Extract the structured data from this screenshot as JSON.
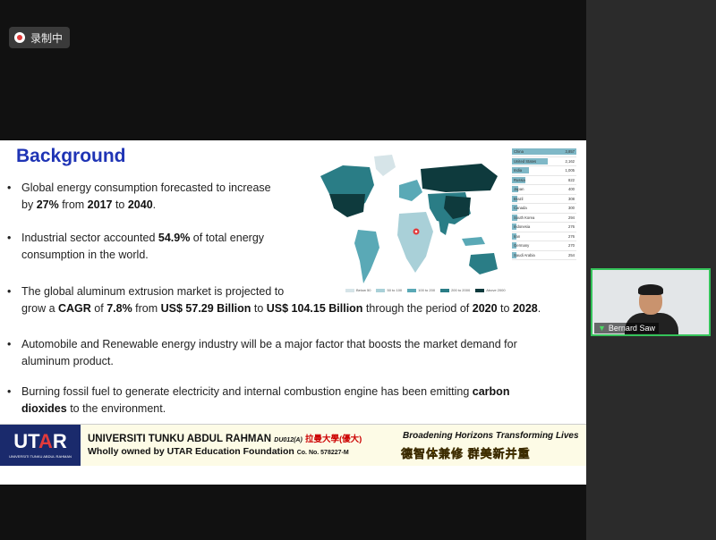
{
  "recording": {
    "label": "录制中"
  },
  "slide": {
    "title": "Background",
    "bullets": [
      {
        "parts": [
          [
            "Global energy consumption forecasted to increase",
            ""
          ],
          [
            "\nby ",
            ""
          ],
          [
            "27%",
            "b"
          ],
          [
            " from ",
            ""
          ],
          [
            "2017",
            "b"
          ],
          [
            " to ",
            ""
          ],
          [
            "2040",
            "b"
          ],
          [
            ".",
            ""
          ]
        ]
      },
      {
        "parts": [
          [
            "Industrial sector accounted ",
            ""
          ],
          [
            "54.9%",
            "b"
          ],
          [
            " of total energy\nconsumption in the world.",
            ""
          ]
        ]
      },
      {
        "parts": [
          [
            "The global aluminum extrusion market is projected to\ngrow a ",
            ""
          ],
          [
            "CAGR",
            "b"
          ],
          [
            " of ",
            ""
          ],
          [
            "7.8%",
            "b"
          ],
          [
            " from ",
            ""
          ],
          [
            "US$ 57.29 Billion",
            "b"
          ],
          [
            " to ",
            ""
          ],
          [
            "US$ 104.15 Billion",
            "b"
          ],
          [
            " through the period of ",
            ""
          ],
          [
            "2020",
            "b"
          ],
          [
            " to ",
            ""
          ],
          [
            "2028",
            "b"
          ],
          [
            ".",
            ""
          ]
        ]
      },
      {
        "parts": [
          [
            "Automobile and Renewable energy industry will be a major factor that boosts the market demand for\naluminum product.",
            ""
          ]
        ]
      },
      {
        "parts": [
          [
            "Burning fossil fuel to generate electricity and internal combustion engine has been emitting ",
            ""
          ],
          [
            "carbon\ndioxides",
            "b"
          ],
          [
            " to the environment.",
            ""
          ]
        ]
      }
    ],
    "map_legend": [
      "Below 50",
      "50 to 100",
      "100 to 200",
      "200 to 2000",
      "Above 2000"
    ],
    "ranking": [
      {
        "country": "China",
        "value": "3,857",
        "frac": 1.0
      },
      {
        "country": "United States",
        "value": "2,162",
        "frac": 0.56
      },
      {
        "country": "India",
        "value": "1,005",
        "frac": 0.26
      },
      {
        "country": "Russia",
        "value": "822",
        "frac": 0.21
      },
      {
        "country": "Japan",
        "value": "400",
        "frac": 0.1
      },
      {
        "country": "Brazil",
        "value": "308",
        "frac": 0.08
      },
      {
        "country": "Canada",
        "value": "300",
        "frac": 0.08
      },
      {
        "country": "South Korea",
        "value": "294",
        "frac": 0.08
      },
      {
        "country": "Indonesia",
        "value": "276",
        "frac": 0.07
      },
      {
        "country": "Iran",
        "value": "276",
        "frac": 0.07
      },
      {
        "country": "Germany",
        "value": "270",
        "frac": 0.07
      },
      {
        "country": "Saudi Arabia",
        "value": "254",
        "frac": 0.07
      }
    ],
    "footer": {
      "logo_main": "UT",
      "logo_accent": "A",
      "logo_end": "R",
      "logo_sub": "UNIVERSITI TUNKU ABDUL RAHMAN",
      "uni_name": "UNIVERSITI TUNKU ABDUL RAHMAN",
      "uni_code": "DU012(A)",
      "uni_cn": "拉曼大學(優大)",
      "owned": "Wholly owned by UTAR Education Foundation",
      "co_no": "Co. No. 578227-M",
      "tagline": "Broadening Horizons  Transforming Lives",
      "motto": "德智体兼修 群美新并重"
    }
  },
  "participant": {
    "name": "Bernard Saw"
  },
  "colors": {
    "title": "#1f34b5",
    "accent_green": "#35c35a",
    "legend": [
      "#d6e4e8",
      "#a9d0d8",
      "#5aa9b6",
      "#2a7d86",
      "#0e3a3d"
    ]
  }
}
